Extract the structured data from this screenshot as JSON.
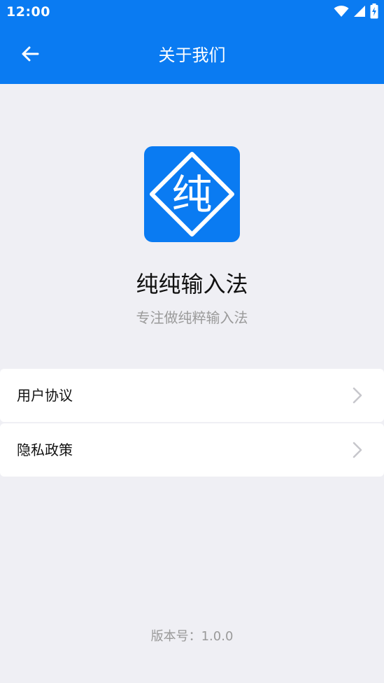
{
  "status_bar": {
    "time": "12:00"
  },
  "header": {
    "title": "关于我们"
  },
  "app": {
    "logo_char": "纯",
    "name": "纯纯输入法",
    "slogan": "专注做纯粹输入法"
  },
  "menu": {
    "items": [
      {
        "label": "用户协议"
      },
      {
        "label": "隐私政策"
      }
    ]
  },
  "footer": {
    "version": "版本号：1.0.0"
  },
  "colors": {
    "primary": "#0a7bf2",
    "background": "#efeff4",
    "card": "#ffffff",
    "text_primary": "#111111",
    "text_secondary": "#9a9a9a",
    "chevron": "#c7c7cc"
  },
  "icons": {
    "wifi": "wifi-icon",
    "signal": "cell-signal-icon",
    "battery": "battery-charging-icon",
    "back": "arrow-left-icon",
    "chevron": "chevron-right-icon"
  }
}
